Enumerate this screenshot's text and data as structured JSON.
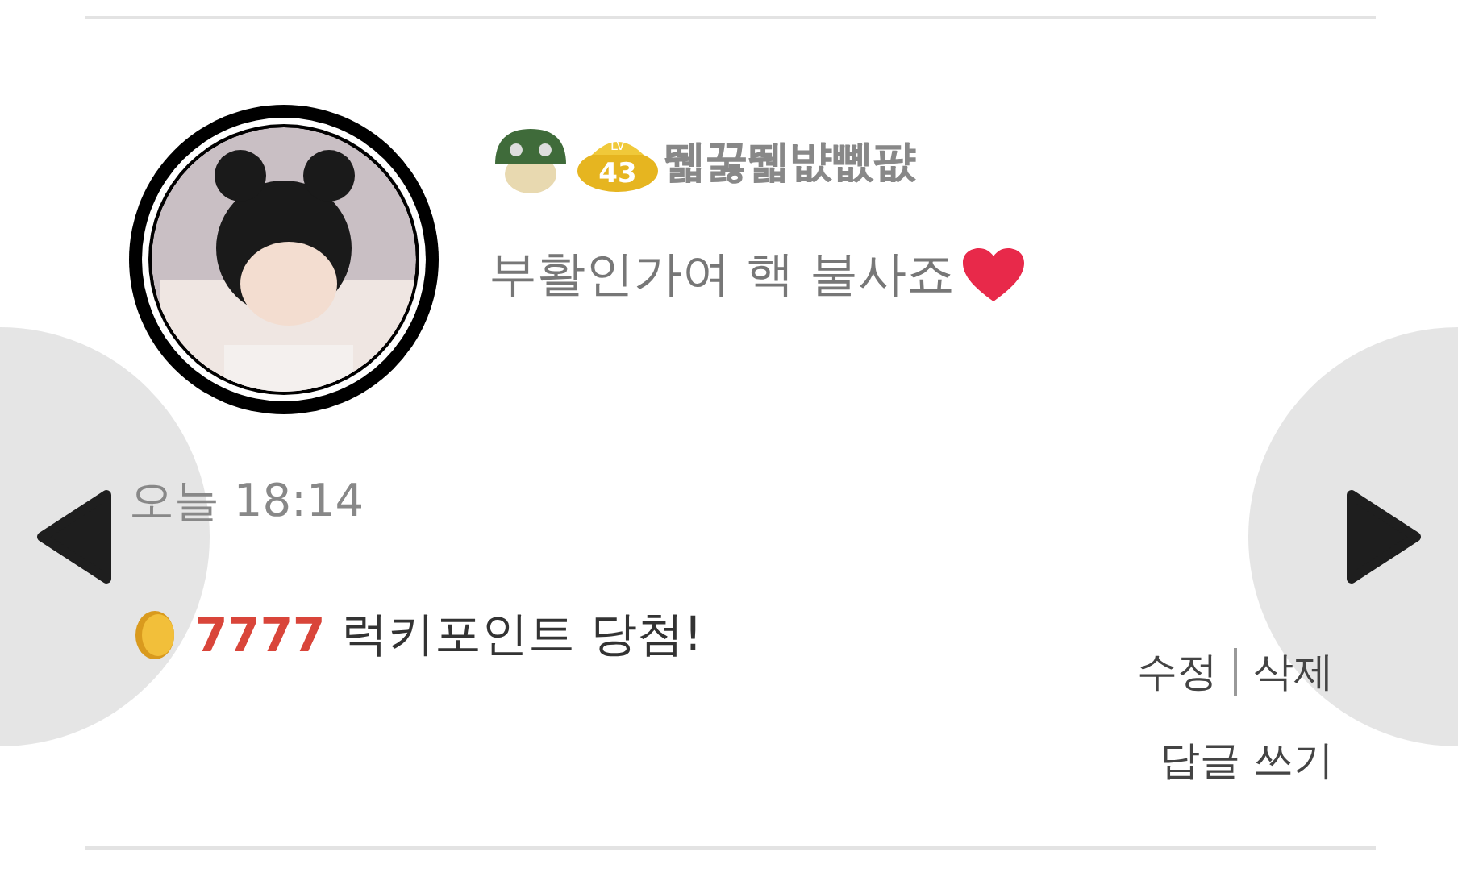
{
  "comment": {
    "level_badge": "43",
    "level_prefix": "LV",
    "nickname": "뛟꿇뛟뱞뼶퍖",
    "message": "부활인가여 핵 불사죠",
    "time": "오늘 18:14",
    "points": "7777",
    "points_text": "럭키포인트 당첨!",
    "actions": [
      "수정",
      "삭제"
    ],
    "reply": "답글 쓰기"
  }
}
